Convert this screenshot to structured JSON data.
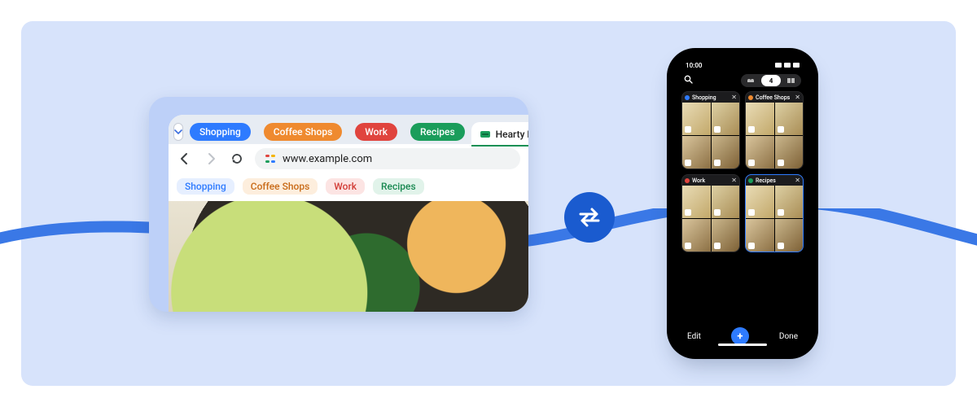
{
  "browser": {
    "tab_groups": [
      {
        "label": "Shopping",
        "color": "blue"
      },
      {
        "label": "Coffee Shops",
        "color": "orange"
      },
      {
        "label": "Work",
        "color": "red"
      },
      {
        "label": "Recipes",
        "color": "green"
      }
    ],
    "open_tab": {
      "label": "Hearty Herb"
    },
    "address": "www.example.com",
    "bookmarks": [
      {
        "label": "Shopping",
        "tone": "blue"
      },
      {
        "label": "Coffee Shops",
        "tone": "orange"
      },
      {
        "label": "Work",
        "tone": "red"
      },
      {
        "label": "Recipes",
        "tone": "green"
      }
    ]
  },
  "phone": {
    "status": {
      "time": "10:00"
    },
    "segment_count": "4",
    "groups": [
      {
        "label": "Shopping",
        "color": "blue"
      },
      {
        "label": "Coffee Shops",
        "color": "orange"
      },
      {
        "label": "Work",
        "color": "red"
      },
      {
        "label": "Recipes",
        "color": "green",
        "selected": true
      }
    ],
    "bottom": {
      "edit": "Edit",
      "done": "Done"
    }
  }
}
